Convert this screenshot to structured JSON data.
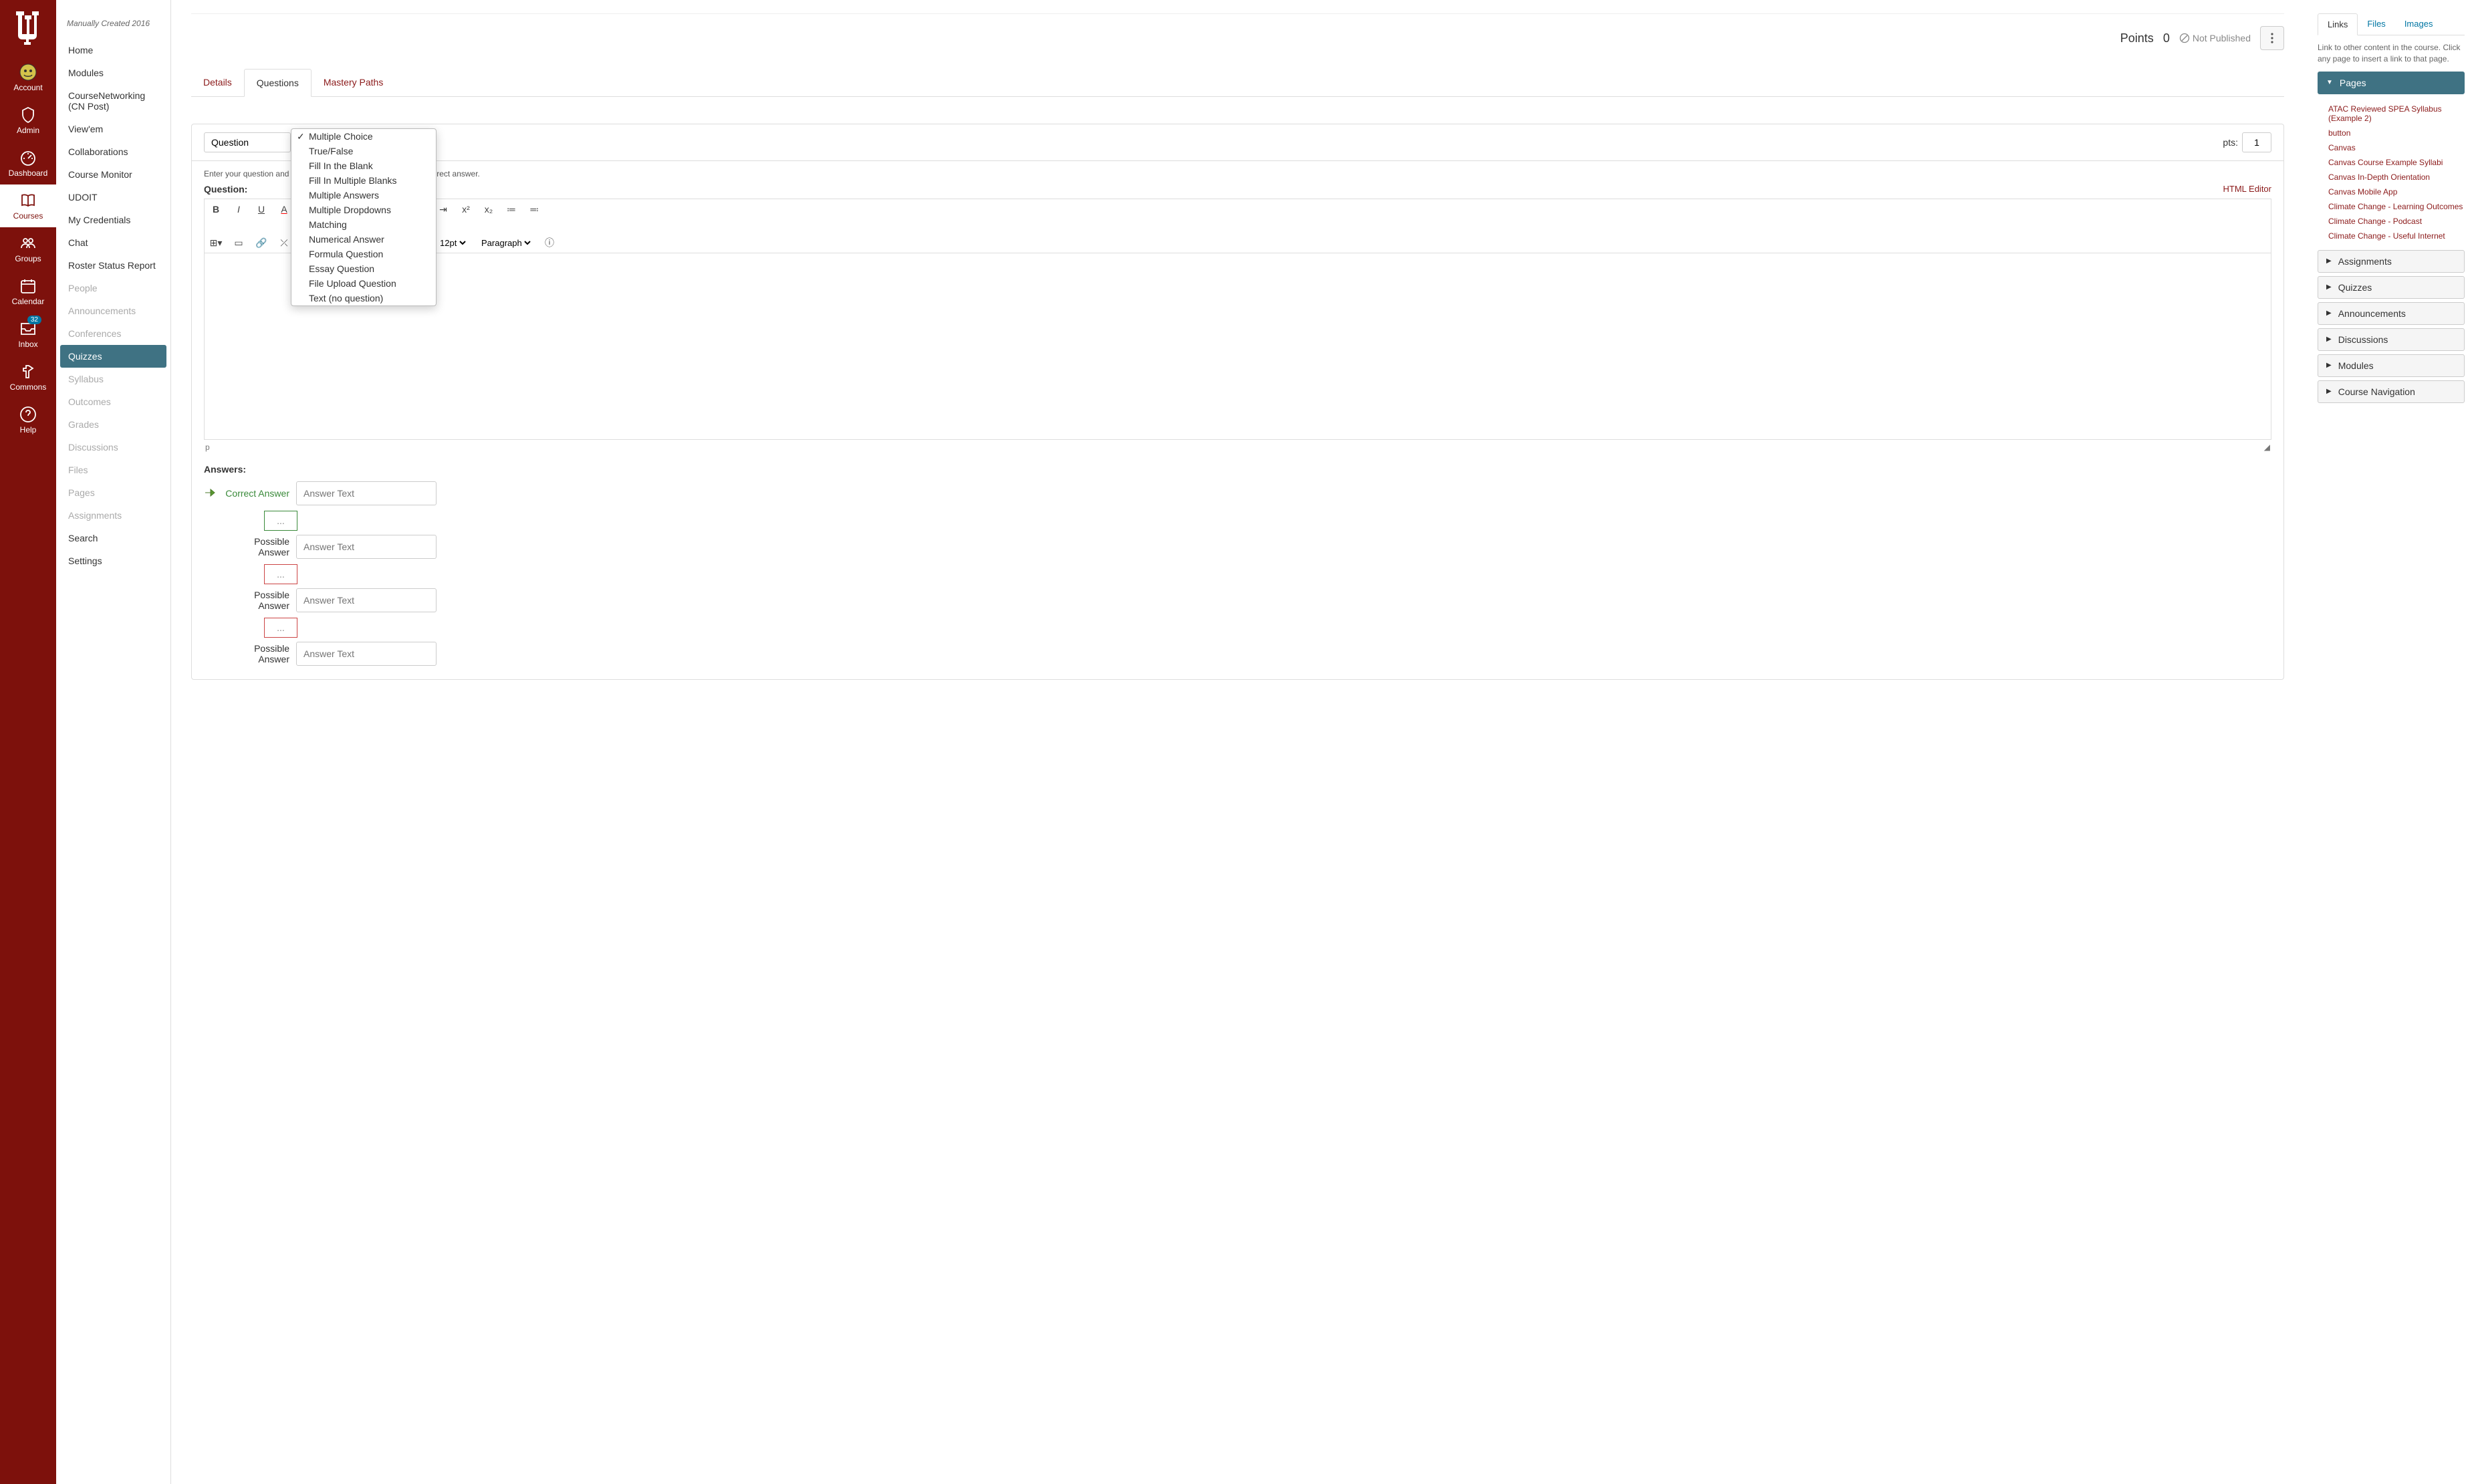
{
  "global_nav": {
    "items": [
      {
        "label": "Account"
      },
      {
        "label": "Admin"
      },
      {
        "label": "Dashboard"
      },
      {
        "label": "Courses"
      },
      {
        "label": "Groups"
      },
      {
        "label": "Calendar"
      },
      {
        "label": "Inbox",
        "badge": "32"
      },
      {
        "label": "Commons"
      },
      {
        "label": "Help"
      }
    ]
  },
  "course_nav": {
    "term": "Manually Created 2016",
    "items": [
      {
        "label": "Home"
      },
      {
        "label": "Modules"
      },
      {
        "label": "CourseNetworking (CN Post)"
      },
      {
        "label": "View'em"
      },
      {
        "label": "Collaborations"
      },
      {
        "label": "Course Monitor"
      },
      {
        "label": "UDOIT"
      },
      {
        "label": "My Credentials"
      },
      {
        "label": "Chat"
      },
      {
        "label": "Roster Status Report"
      },
      {
        "label": "People",
        "muted": true
      },
      {
        "label": "Announcements",
        "muted": true
      },
      {
        "label": "Conferences",
        "muted": true
      },
      {
        "label": "Quizzes",
        "active": true,
        "muted": true
      },
      {
        "label": "Syllabus",
        "muted": true
      },
      {
        "label": "Outcomes",
        "muted": true
      },
      {
        "label": "Grades",
        "muted": true
      },
      {
        "label": "Discussions",
        "muted": true
      },
      {
        "label": "Files",
        "muted": true
      },
      {
        "label": "Pages",
        "muted": true
      },
      {
        "label": "Assignments",
        "muted": true
      },
      {
        "label": "Search"
      },
      {
        "label": "Settings"
      }
    ]
  },
  "header": {
    "points_label": "Points",
    "points_value": "0",
    "not_published": "Not Published"
  },
  "tabs": [
    {
      "label": "Details"
    },
    {
      "label": "Questions",
      "active": true
    },
    {
      "label": "Mastery Paths"
    }
  ],
  "question": {
    "name": "Question",
    "pts_label": "pts:",
    "pts_value": "1",
    "type_options": [
      "Multiple Choice",
      "True/False",
      "Fill In the Blank",
      "Fill In Multiple Blanks",
      "Multiple Answers",
      "Multiple Dropdowns",
      "Matching",
      "Numerical Answer",
      "Formula Question",
      "Essay Question",
      "File Upload Question",
      "Text (no question)"
    ],
    "selected_type": "Multiple Choice",
    "instruction": "Enter your question and multiple answers, then select the one correct answer.",
    "question_label": "Question:",
    "html_editor": "HTML Editor",
    "font_size": "12pt",
    "para": "Paragraph",
    "path": "p",
    "answers_label": "Answers:",
    "correct_label": "Correct Answer",
    "possible_label": "Possible Answer",
    "answer_placeholder": "Answer Text",
    "ellipsis": "..."
  },
  "right": {
    "tabs": [
      "Links",
      "Files",
      "Images"
    ],
    "help": "Link to other content in the course. Click any page to insert a link to that page.",
    "sections": [
      "Pages",
      "Assignments",
      "Quizzes",
      "Announcements",
      "Discussions",
      "Modules",
      "Course Navigation"
    ],
    "pages_items": [
      "ATAC Reviewed SPEA Syllabus (Example 2)",
      "button",
      "Canvas",
      "Canvas Course Example Syllabi",
      "Canvas In-Depth Orientation",
      "Canvas Mobile App",
      "Climate Change - Learning Outcomes",
      "Climate Change - Podcast",
      "Climate Change - Useful Internet"
    ]
  }
}
